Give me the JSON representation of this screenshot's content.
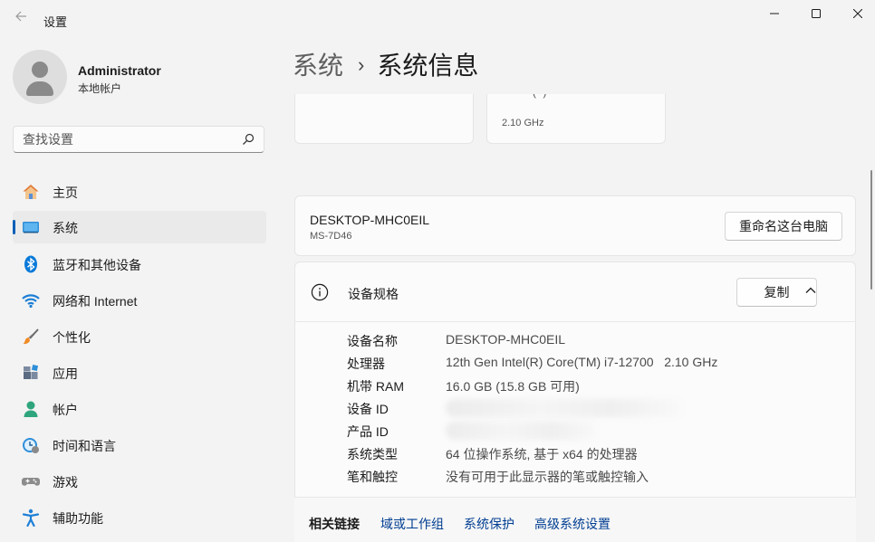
{
  "window": {
    "title": "设置"
  },
  "user": {
    "name": "Administrator",
    "account_type": "本地帐户"
  },
  "search": {
    "placeholder": "查找设置"
  },
  "sidebar": {
    "items": [
      {
        "label": "主页",
        "icon": "home-icon"
      },
      {
        "label": "系统",
        "icon": "system-monitor-icon",
        "active": true
      },
      {
        "label": "蓝牙和其他设备",
        "icon": "bluetooth-icon"
      },
      {
        "label": "网络和 Internet",
        "icon": "wifi-icon"
      },
      {
        "label": "个性化",
        "icon": "brush-icon"
      },
      {
        "label": "应用",
        "icon": "apps-icon"
      },
      {
        "label": "帐户",
        "icon": "person-icon"
      },
      {
        "label": "时间和语言",
        "icon": "globe-clock-icon"
      },
      {
        "label": "游戏",
        "icon": "gamepad-icon"
      },
      {
        "label": "辅助功能",
        "icon": "accessibility-icon"
      }
    ]
  },
  "breadcrumb": {
    "parent": "系统",
    "separator": "›",
    "current": "系统信息"
  },
  "top_cards": {
    "clipped_text": "( )",
    "frequency": "2.10 GHz"
  },
  "pc": {
    "name": "DESKTOP-MHC0EIL",
    "model": "MS-7D46",
    "rename_button": "重命名这台电脑"
  },
  "specs": {
    "title": "设备规格",
    "copy_button": "复制",
    "rows": [
      {
        "label": "设备名称",
        "value": "DESKTOP-MHC0EIL"
      },
      {
        "label": "处理器",
        "value": "12th Gen Intel(R) Core(TM) i7-12700   2.10 GHz"
      },
      {
        "label": "机带 RAM",
        "value": "16.0 GB (15.8 GB 可用)"
      },
      {
        "label": "设备 ID",
        "value": ""
      },
      {
        "label": "产品 ID",
        "value": ""
      },
      {
        "label": "系统类型",
        "value": "64 位操作系统, 基于 x64 的处理器"
      },
      {
        "label": "笔和触控",
        "value": "没有可用于此显示器的笔或触控输入"
      }
    ]
  },
  "related_links": {
    "label": "相关链接",
    "links": [
      "域或工作组",
      "系统保护",
      "高级系统设置"
    ]
  },
  "colors": {
    "accent": "#005fb8",
    "link": "#003e92",
    "background": "#f3f3f3"
  }
}
